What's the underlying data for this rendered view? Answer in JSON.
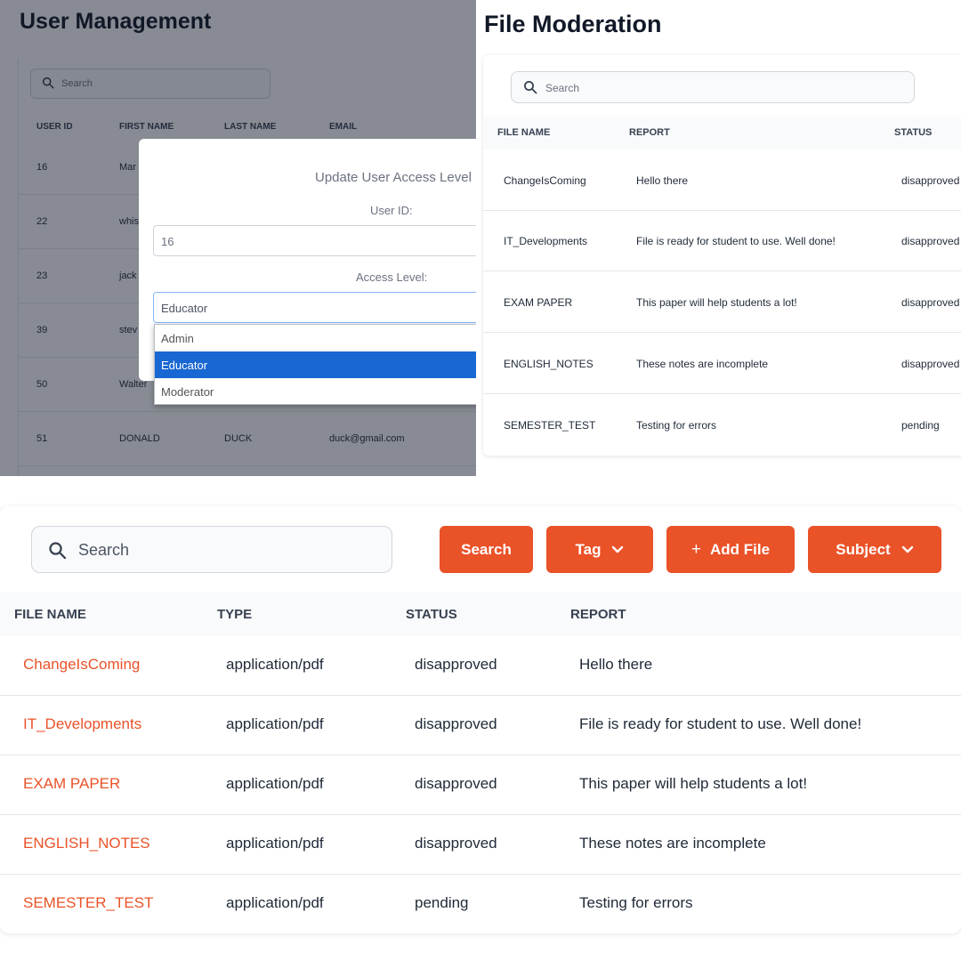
{
  "user_management": {
    "title": "User Management",
    "search_placeholder": "Search",
    "columns": [
      "USER ID",
      "FIRST NAME",
      "LAST NAME",
      "EMAIL"
    ],
    "rows": [
      {
        "id": "16",
        "first": "Mar",
        "last": "",
        "email": ""
      },
      {
        "id": "22",
        "first": "whis",
        "last": "",
        "email": ""
      },
      {
        "id": "23",
        "first": "jack",
        "last": "",
        "email": ""
      },
      {
        "id": "39",
        "first": "stev",
        "last": "",
        "email": ""
      },
      {
        "id": "50",
        "first": "Walter",
        "last": "",
        "email": ""
      },
      {
        "id": "51",
        "first": "DONALD",
        "last": "DUCK",
        "email": "duck@gmail.com"
      }
    ],
    "modal": {
      "title": "Update User Access Level",
      "user_id_label": "User ID:",
      "user_id_value": "16",
      "access_label": "Access Level:",
      "access_value": "Educator",
      "options": [
        "Admin",
        "Educator",
        "Moderator"
      ],
      "selected_option": "Educator"
    }
  },
  "file_moderation": {
    "title": "File Moderation",
    "search_placeholder": "Search",
    "columns": [
      "FILE NAME",
      "REPORT",
      "STATUS"
    ],
    "rows": [
      {
        "name": "ChangeIsComing",
        "report": "Hello there",
        "status": "disapproved"
      },
      {
        "name": "IT_Developments",
        "report": "File is ready for student to use. Well done!",
        "status": "disapproved"
      },
      {
        "name": "EXAM PAPER",
        "report": "This paper will help students a lot!",
        "status": "disapproved"
      },
      {
        "name": "ENGLISH_NOTES",
        "report": "These notes are incomplete",
        "status": "disapproved"
      },
      {
        "name": "SEMESTER_TEST",
        "report": "Testing for errors",
        "status": "pending"
      }
    ]
  },
  "file_list": {
    "search_placeholder": "Search",
    "buttons": {
      "search": "Search",
      "tag": "Tag",
      "add_file": "Add File",
      "add_file_prefix": "+",
      "subject": "Subject"
    },
    "columns": [
      "FILE NAME",
      "TYPE",
      "STATUS",
      "REPORT"
    ],
    "rows": [
      {
        "name": "ChangeIsComing",
        "type": "application/pdf",
        "status": "disapproved",
        "report": "Hello there"
      },
      {
        "name": "IT_Developments",
        "type": "application/pdf",
        "status": "disapproved",
        "report": "File is ready for student to use. Well done!"
      },
      {
        "name": "EXAM PAPER",
        "type": "application/pdf",
        "status": "disapproved",
        "report": "This paper will help students a lot!"
      },
      {
        "name": "ENGLISH_NOTES",
        "type": "application/pdf",
        "status": "disapproved",
        "report": "These notes are incomplete"
      },
      {
        "name": "SEMESTER_TEST",
        "type": "application/pdf",
        "status": "pending",
        "report": "Testing for errors"
      }
    ]
  },
  "colors": {
    "accent": "#ea5228",
    "selected_option": "#1967d2",
    "overlay": "#111827"
  },
  "icons": [
    "search-icon",
    "chevron-down-icon",
    "plus-icon"
  ]
}
